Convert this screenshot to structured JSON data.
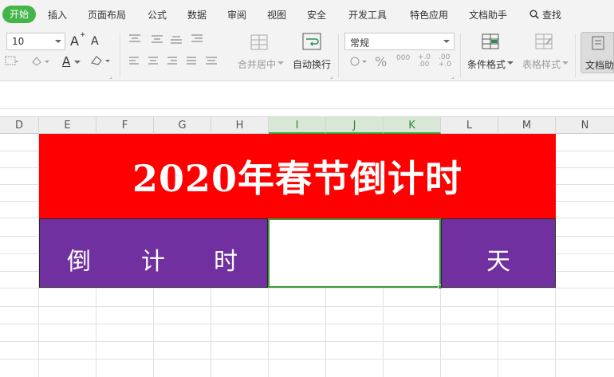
{
  "menu": {
    "start": "开始",
    "items": [
      "插入",
      "页面布局",
      "公式",
      "数据",
      "审阅",
      "视图",
      "安全",
      "开发工具",
      "特色应用",
      "文档助手"
    ],
    "search": "查找"
  },
  "toolbar": {
    "font_size": "10",
    "font_grow": "A",
    "font_shrink": "A",
    "font_color_letter": "A",
    "merge_center": "合并居中",
    "wrap_text": "自动换行",
    "number_format": "常规",
    "percent": "%",
    "thousands": "000",
    "inc_decimal": "+.0 .00",
    "dec_decimal": ".00 +.0",
    "conditional_format": "条件格式",
    "table_style": "表格样式",
    "doc_helper": "文档助"
  },
  "columns": [
    "D",
    "E",
    "F",
    "G",
    "H",
    "I",
    "J",
    "K",
    "L",
    "M",
    "N"
  ],
  "selected_columns": [
    "I",
    "J",
    "K"
  ],
  "sheet": {
    "title": "2020年春节倒计时",
    "countdown_chars": [
      "倒",
      "计",
      "时"
    ],
    "days_label": "天",
    "days_value": ""
  },
  "colors": {
    "title_bg": "#ff0000",
    "purple": "#7030a0",
    "selection_green": "#3a9b3a",
    "start_tab": "#44b549"
  }
}
